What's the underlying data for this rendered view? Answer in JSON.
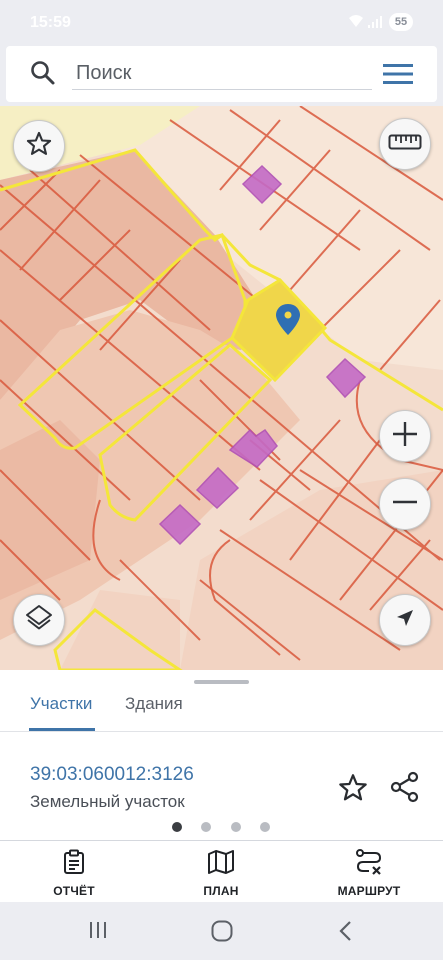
{
  "status": {
    "time": "15:59",
    "battery": "55"
  },
  "search": {
    "placeholder": "Поиск"
  },
  "icons": {
    "search": "search-icon",
    "menu": "hamburger-menu-icon",
    "favorite": "star-outline-icon",
    "ruler": "ruler-icon",
    "zoom_in": "plus-icon",
    "zoom_out": "minus-icon",
    "layers": "layers-icon",
    "locate": "navigation-arrow-icon",
    "share": "share-icon",
    "report": "clipboard-icon",
    "plan": "map-icon",
    "route": "route-icon"
  },
  "colors": {
    "accent": "#3f74a8",
    "selected_parcel": "#f0d64a",
    "highlight_border": "#f4e63a",
    "parcel_border": "#d9583c",
    "building": "#c46ac6"
  },
  "sheet": {
    "tabs": [
      {
        "label": "Участки",
        "active": true
      },
      {
        "label": "Здания",
        "active": false
      }
    ],
    "parcel": {
      "id": "39:03:060012:3126",
      "type": "Земельный участок"
    },
    "pager": {
      "pages": 4,
      "current": 1
    }
  },
  "bottom_nav": [
    {
      "label": "ОТЧЁТ"
    },
    {
      "label": "ПЛАН"
    },
    {
      "label": "МАРШРУТ"
    }
  ]
}
